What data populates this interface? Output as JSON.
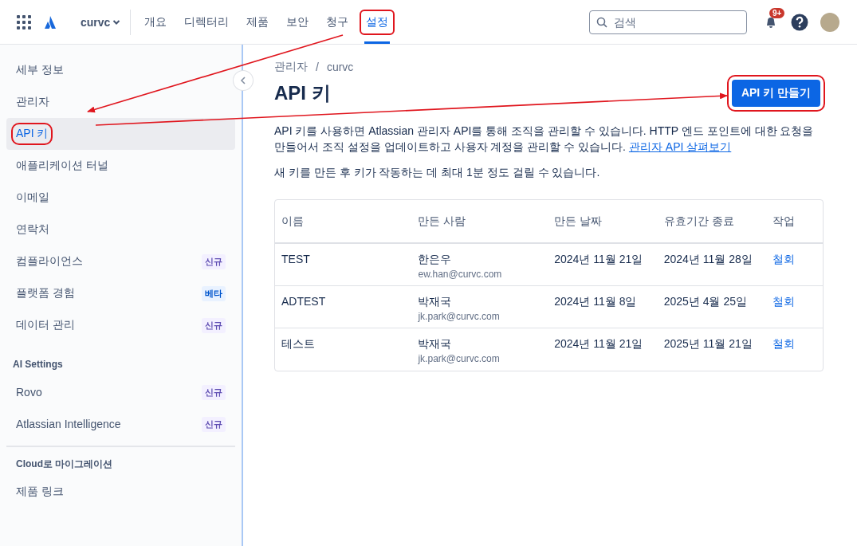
{
  "top_bar": {
    "org": "curvc",
    "nav": [
      {
        "label": "개요",
        "selected": false,
        "highlighted": false
      },
      {
        "label": "디렉터리",
        "selected": false,
        "highlighted": false
      },
      {
        "label": "제품",
        "selected": false,
        "highlighted": false
      },
      {
        "label": "보안",
        "selected": false,
        "highlighted": false
      },
      {
        "label": "청구",
        "selected": false,
        "highlighted": false
      },
      {
        "label": "설정",
        "selected": true,
        "highlighted": true
      }
    ],
    "search": {
      "placeholder": "검색"
    },
    "notification_count": "9+"
  },
  "sidebar": {
    "sections": [
      {
        "items": [
          {
            "label": "세부 정보",
            "selected": false,
            "highlighted": false
          },
          {
            "label": "관리자",
            "selected": false,
            "highlighted": false
          },
          {
            "label": "API 키",
            "selected": true,
            "highlighted": true
          },
          {
            "label": "애플리케이션 터널",
            "selected": false,
            "highlighted": false
          },
          {
            "label": "이메일",
            "selected": false,
            "highlighted": false
          },
          {
            "label": "연락처",
            "selected": false,
            "highlighted": false
          },
          {
            "label": "컴플라이언스",
            "selected": false,
            "highlighted": false,
            "badge": {
              "text": "신규",
              "kind": "new"
            }
          },
          {
            "label": "플랫폼 경험",
            "selected": false,
            "highlighted": false,
            "badge": {
              "text": "베타",
              "kind": "beta"
            }
          },
          {
            "label": "데이터 관리",
            "selected": false,
            "highlighted": false,
            "badge": {
              "text": "신규",
              "kind": "new"
            }
          }
        ]
      },
      {
        "heading": "AI Settings",
        "items": [
          {
            "label": "Rovo",
            "selected": false,
            "highlighted": false,
            "badge": {
              "text": "신규",
              "kind": "new"
            }
          },
          {
            "label": "Atlassian Intelligence",
            "selected": false,
            "highlighted": false,
            "badge": {
              "text": "신규",
              "kind": "new"
            }
          }
        ]
      },
      {
        "heading": "Cloud로 마이그레이션",
        "divider": true,
        "items": [
          {
            "label": "제품 링크",
            "selected": false,
            "highlighted": false
          }
        ]
      }
    ]
  },
  "main": {
    "breadcrumbs": [
      "관리자",
      "curvc"
    ],
    "breadcrumb_separator": "/",
    "title": "API 키",
    "create_button": {
      "label": "API 키 만들기",
      "highlighted": true
    },
    "description": "API 키를 사용하면 Atlassian 관리자 API를 통해 조직을 관리할 수 있습니다. HTTP 엔드 포인트에 대한 요청을 만들어서 조직 설정을 업데이트하고 사용자 계정을 관리할 수 있습니다. ",
    "description_link": "관리자 API 살펴보기",
    "note": "새 키를 만든 후 키가 작동하는 데 최대 1분 정도 걸릴 수 있습니다.",
    "table": {
      "columns": [
        "이름",
        "만든 사람",
        "만든 날짜",
        "유효기간 종료",
        "작업"
      ],
      "rows": [
        {
          "name": "TEST",
          "creator": "한은우",
          "email": "ew.han@curvc.com",
          "created": "2024년 11월 21일",
          "expires": "2024년 11월 28일",
          "action": "철회"
        },
        {
          "name": "ADTEST",
          "creator": "박재국",
          "email": "jk.park@curvc.com",
          "created": "2024년 11월 8일",
          "expires": "2025년 4월 25일",
          "action": "철회"
        },
        {
          "name": "테스트",
          "creator": "박재국",
          "email": "jk.park@curvc.com",
          "created": "2024년 11월 21일",
          "expires": "2025년 11월 21일",
          "action": "철회"
        }
      ]
    }
  }
}
